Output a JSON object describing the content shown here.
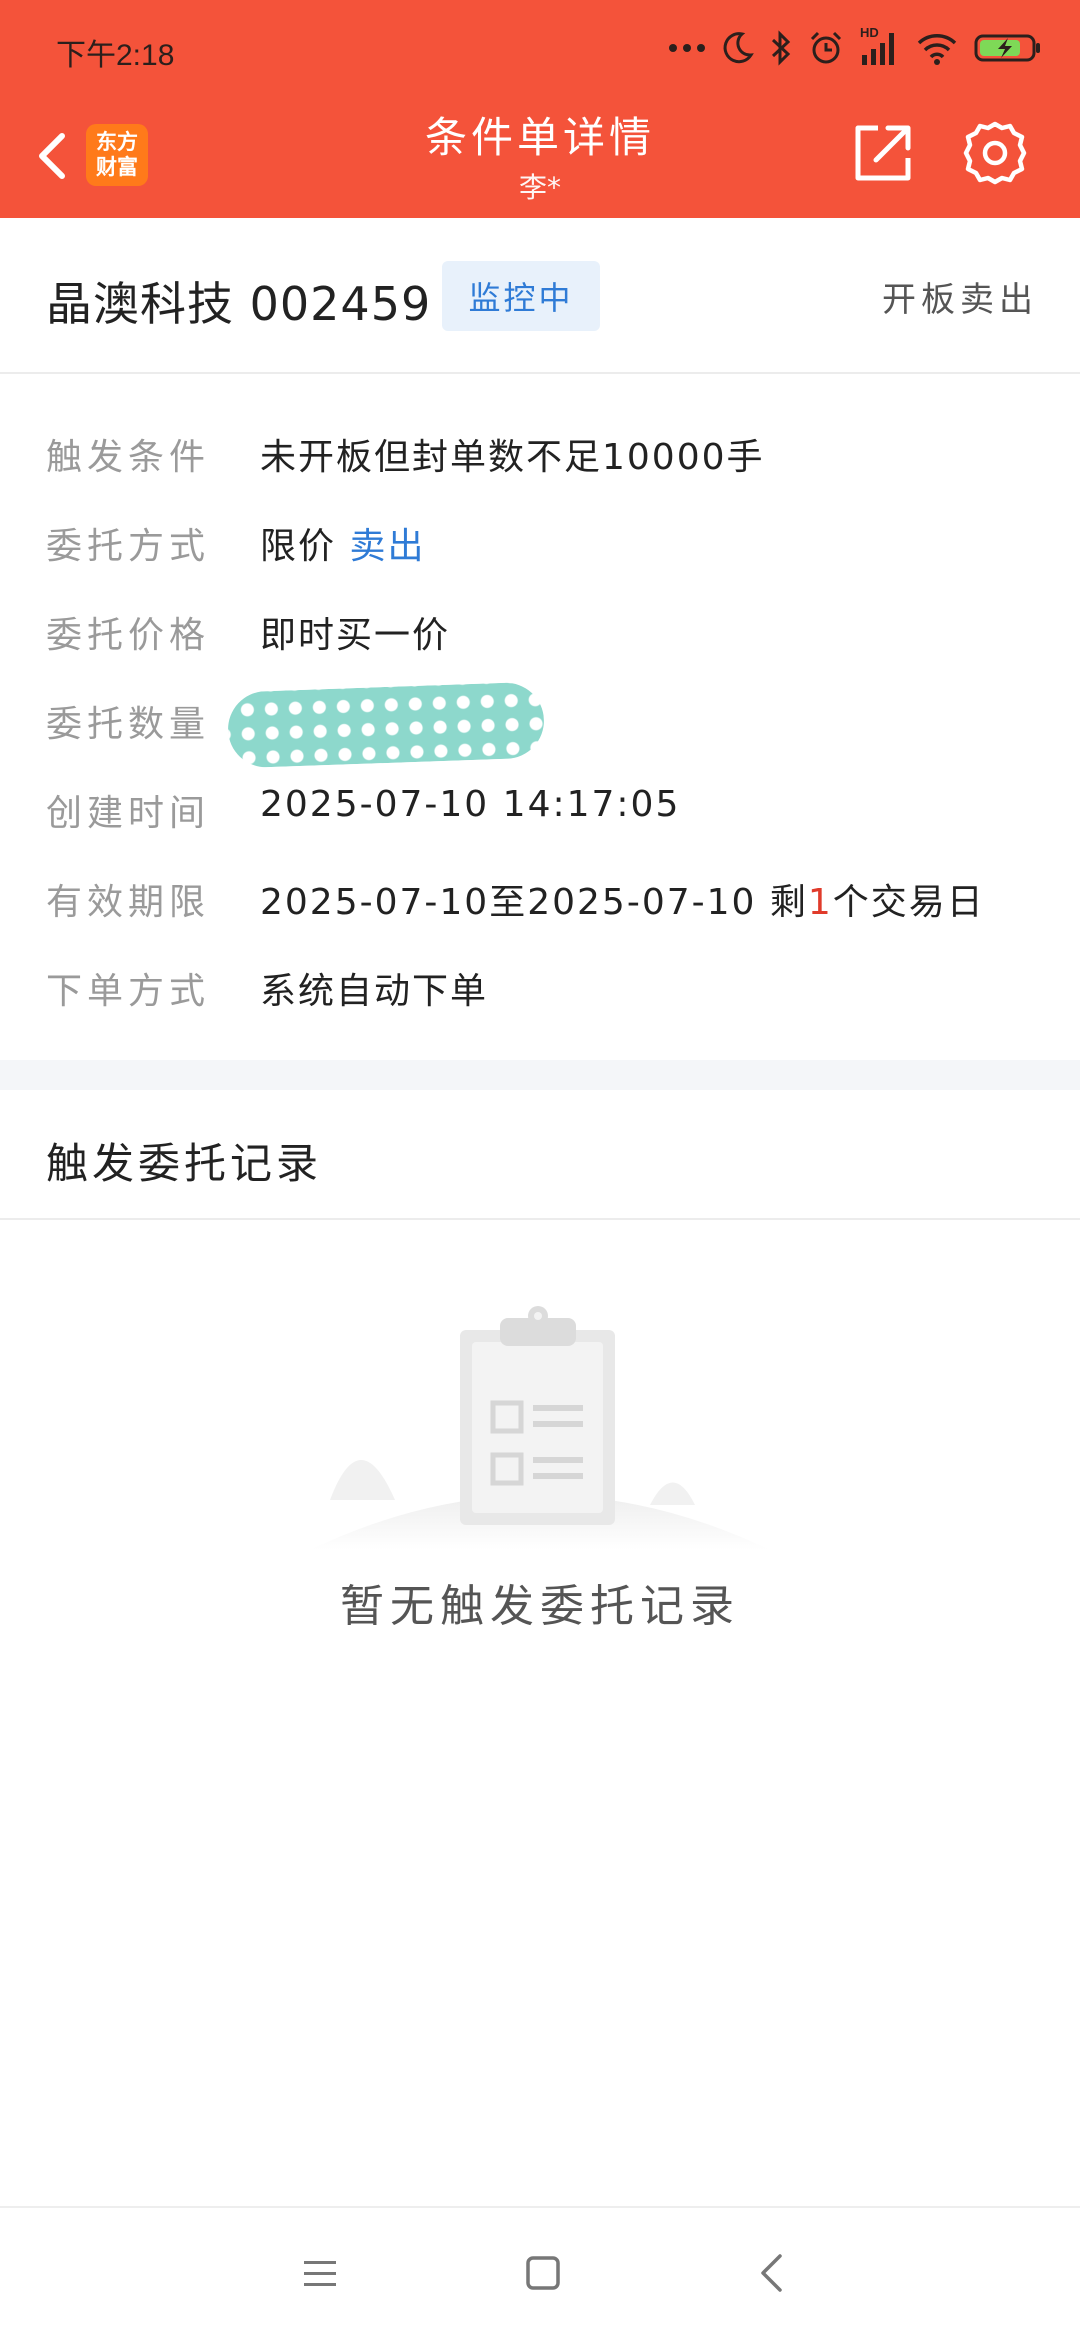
{
  "status_bar": {
    "time": "下午2:18",
    "network_label": "HD",
    "icons": [
      "more-dots-icon",
      "moon-icon",
      "bluetooth-icon",
      "alarm-icon",
      "signal-icon",
      "wifi-icon",
      "battery-charging-icon"
    ]
  },
  "header": {
    "title": "条件单详情",
    "subtitle": "李*",
    "brand_logo_line1": "东方",
    "brand_logo_line2": "财富",
    "colors": {
      "header_bg": "#f4533a",
      "brand_bg": "#ff7a1a"
    }
  },
  "stock": {
    "name_code": "晶澳科技 002459",
    "status": "监控中",
    "order_type": "开板卖出"
  },
  "details": {
    "trigger_label": "触发条件",
    "trigger_value": "未开板但封单数不足10000手",
    "method_label": "委托方式",
    "method_value": "限价",
    "method_side": "卖出",
    "price_label": "委托价格",
    "price_value": "即时买一价",
    "qty_label": "委托数量",
    "created_label": "创建时间",
    "created_value": "2025-07-10 14:17:05",
    "validity_label": "有效期限",
    "validity_value": "2025-07-10至2025-07-10 剩",
    "validity_days": "1",
    "validity_suffix": "个交易日",
    "placement_label": "下单方式",
    "placement_value": "系统自动下单"
  },
  "records": {
    "title": "触发委托记录",
    "empty_text": "暂无触发委托记录"
  },
  "nav": {
    "icons": [
      "menu-icon",
      "home-square-icon",
      "back-arrow-icon"
    ]
  }
}
